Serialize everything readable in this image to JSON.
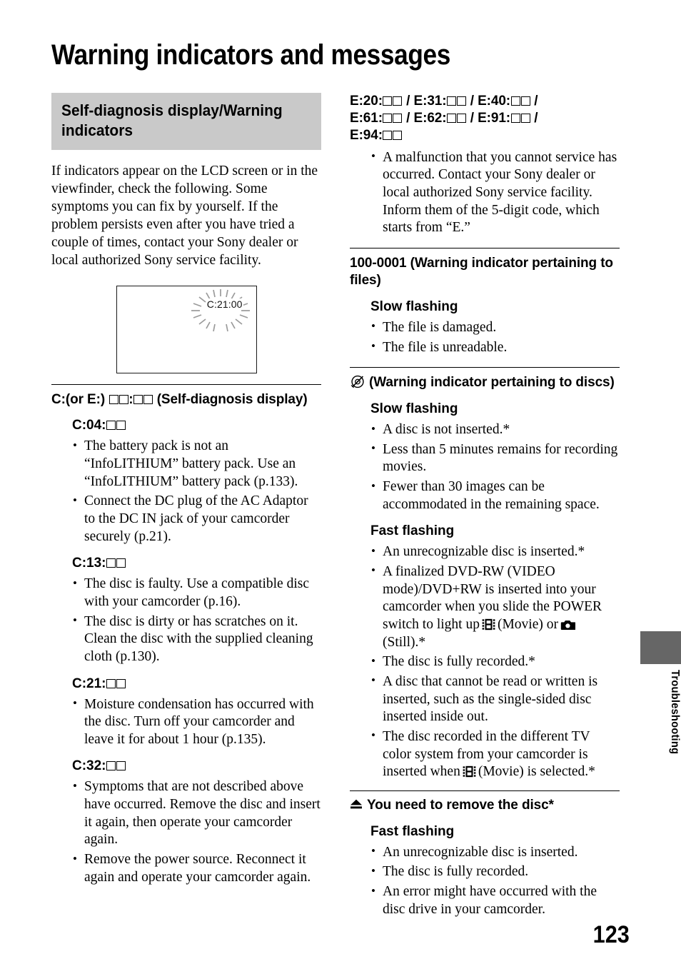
{
  "document": {
    "title": "Warning indicators and messages",
    "page_number": "123",
    "side_tab_label": "Troubleshooting"
  },
  "left_column": {
    "section_header": "Self-diagnosis display/Warning indicators",
    "intro_paragraph": "If indicators appear on the LCD screen or in the viewfinder, check the following. Some symptoms you can fix by yourself. If the problem persists even after you have tried a couple of times, contact your Sony dealer or local authorized Sony service facility.",
    "figure": {
      "name": "lcd-screen-illustration",
      "display_code": "C:21:00"
    },
    "heading": "C:(or E:) □□:□□ (Self-diagnosis display)",
    "heading_parts": {
      "prefix": "C:(or E:)",
      "suffix": "(Self-diagnosis display)"
    },
    "subsections": [
      {
        "code": "C:04:",
        "bullets": [
          "The battery pack is not an “InfoLITHIUM” battery pack. Use an “InfoLITHIUM” battery pack (p.133).",
          "Connect the DC plug of the AC Adaptor to the DC IN jack of your camcorder securely (p.21)."
        ]
      },
      {
        "code": "C:13:",
        "bullets": [
          "The disc is faulty. Use a compatible disc with your camcorder (p.16).",
          "The disc is dirty or has scratches on it. Clean the disc with the supplied cleaning cloth (p.130)."
        ]
      },
      {
        "code": "C:21:",
        "bullets": [
          "Moisture condensation has occurred with the disc. Turn off your camcorder and leave it for about 1 hour (p.135)."
        ]
      },
      {
        "code": "C:32:",
        "bullets": [
          "Symptoms that are not described above have occurred. Remove the disc and insert it again, then operate your camcorder again.",
          "Remove the power source. Reconnect it again and operate your camcorder again."
        ]
      }
    ]
  },
  "right_column": {
    "error_codes_heading": {
      "line1_a": "E:20:",
      "line1_b": "E:31:",
      "line1_c": "E:40:",
      "line2_a": "E:61:",
      "line2_b": "E:62:",
      "line2_c": "E:91:",
      "line3_a": "E:94:",
      "separator": "/"
    },
    "error_codes_bullets": [
      "A malfunction that you cannot service has occurred. Contact your Sony dealer or local authorized Sony service facility. Inform them of the 5-digit code, which starts from “E.”"
    ],
    "files_section": {
      "heading": "100-0001 (Warning indicator pertaining to files)",
      "sub_heading": "Slow flashing",
      "bullets": [
        "The file is damaged.",
        "The file is unreadable."
      ]
    },
    "discs_section": {
      "icon": "disc-warning-icon",
      "heading": "(Warning indicator pertaining to discs)",
      "slow_flashing_label": "Slow flashing",
      "slow_flashing_bullets": [
        "A disc is not inserted.*",
        "Less than 5 minutes remains for recording movies.",
        "Fewer than 30 images can be accommodated in the remaining space."
      ],
      "fast_flashing_label": "Fast flashing",
      "fast_flashing_bullets": [
        {
          "text_before": "An unrecognizable disc is inserted.*",
          "icons": []
        },
        {
          "text_before": "A finalized DVD-RW (VIDEO mode)/DVD+RW is inserted into your camcorder when you slide the POWER switch to light up",
          "icon1": "movie-icon",
          "text_mid1": "(Movie) or",
          "icon2": "still-icon",
          "text_after": "(Still).*"
        },
        {
          "text_before": "The disc is fully recorded.*",
          "icons": []
        },
        {
          "text_before": " A disc that cannot be read or written is inserted, such as the single-sided disc inserted inside out.",
          "icons": []
        },
        {
          "text_before": "The disc recorded in the different TV color system from your camcorder is inserted when",
          "icon1": "movie-icon",
          "text_after": "(Movie) is selected.*"
        }
      ]
    },
    "remove_disc_section": {
      "icon": "eject-icon",
      "heading": "You need to remove the disc*",
      "sub_heading": "Fast flashing",
      "bullets": [
        "An unrecognizable disc is inserted.",
        "The disc is fully recorded.",
        "An error might have occurred with the disc drive in your camcorder."
      ]
    }
  },
  "colors": {
    "section_header_bg": "#c9c9c9",
    "side_tab_bg": "#666666",
    "text": "#000000",
    "page_bg": "#ffffff"
  }
}
